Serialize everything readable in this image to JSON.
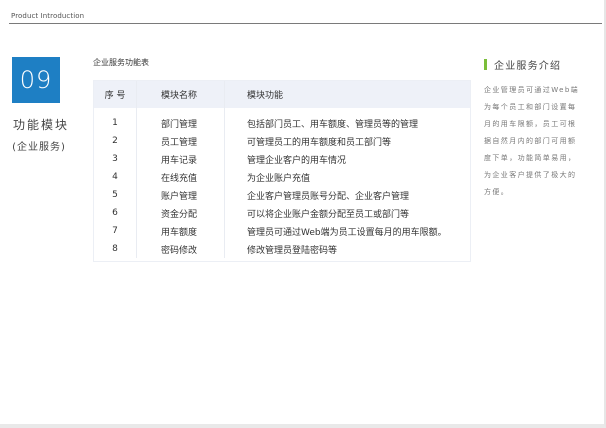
{
  "header": {
    "label": "Product Introduction"
  },
  "section": {
    "number": "09",
    "title": "功能模块",
    "subtitle": "(企业服务)"
  },
  "table": {
    "caption": "企业服务功能表",
    "columns": [
      "序 号",
      "模块名称",
      "模块功能"
    ],
    "rows": [
      {
        "no": "1",
        "name": "部门管理",
        "func": "包括部门员工、用车额度、管理员等的管理"
      },
      {
        "no": "2",
        "name": "员工管理",
        "func": "可管理员工的用车额度和员工部门等"
      },
      {
        "no": "3",
        "name": "用车记录",
        "func": "管理企业客户的用车情况"
      },
      {
        "no": "4",
        "name": "在线充值",
        "func": "为企业账户充值"
      },
      {
        "no": "5",
        "name": "账户管理",
        "func": "企业客户管理员账号分配、企业客户管理"
      },
      {
        "no": "6",
        "name": "资金分配",
        "func": "可以将企业账户金额分配至员工或部门等"
      },
      {
        "no": "7",
        "name": "用车额度",
        "func": "管理员可通过Web端为员工设置每月的用车限额。"
      },
      {
        "no": "8",
        "name": "密码修改",
        "func": "修改管理员登陆密码等"
      }
    ]
  },
  "sidebar": {
    "title": "企业服务介绍",
    "text": "企业管理员可通过Web端为每个员工和部门设置每月的用车限额，员工可根据自然月内的部门可用额度下单，功能简单易用，为企业客户提供了极大的方便。"
  },
  "colors": {
    "accent": "#1e7fc4",
    "bar": "#7bbe3a",
    "header_bg": "#eef1f8"
  }
}
